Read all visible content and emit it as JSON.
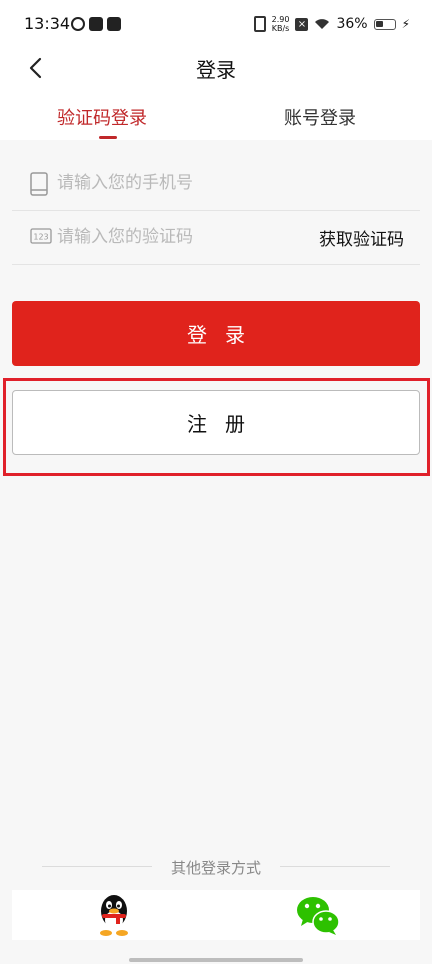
{
  "status_bar": {
    "time": "13:34",
    "speed_value": "2.90",
    "speed_unit": "KB/s",
    "battery": "36%"
  },
  "header": {
    "title": "登录",
    "back_icon": "chevron-left-icon"
  },
  "tabs": [
    {
      "label": "验证码登录",
      "active": true
    },
    {
      "label": "账号登录",
      "active": false
    }
  ],
  "form": {
    "phone_placeholder": "请输入您的手机号",
    "phone_icon": "phone-icon",
    "code_placeholder": "请输入您的验证码",
    "code_icon": "keypad-123-icon",
    "get_code_label": "获取验证码"
  },
  "buttons": {
    "login_label": "登录",
    "register_label": "注册"
  },
  "other_login": {
    "label": "其他登录方式",
    "providers": [
      "qq-icon",
      "wechat-icon"
    ]
  },
  "colors": {
    "accent": "#e0231c",
    "tab_active": "#c0282a",
    "highlight_border": "#e0202a"
  }
}
